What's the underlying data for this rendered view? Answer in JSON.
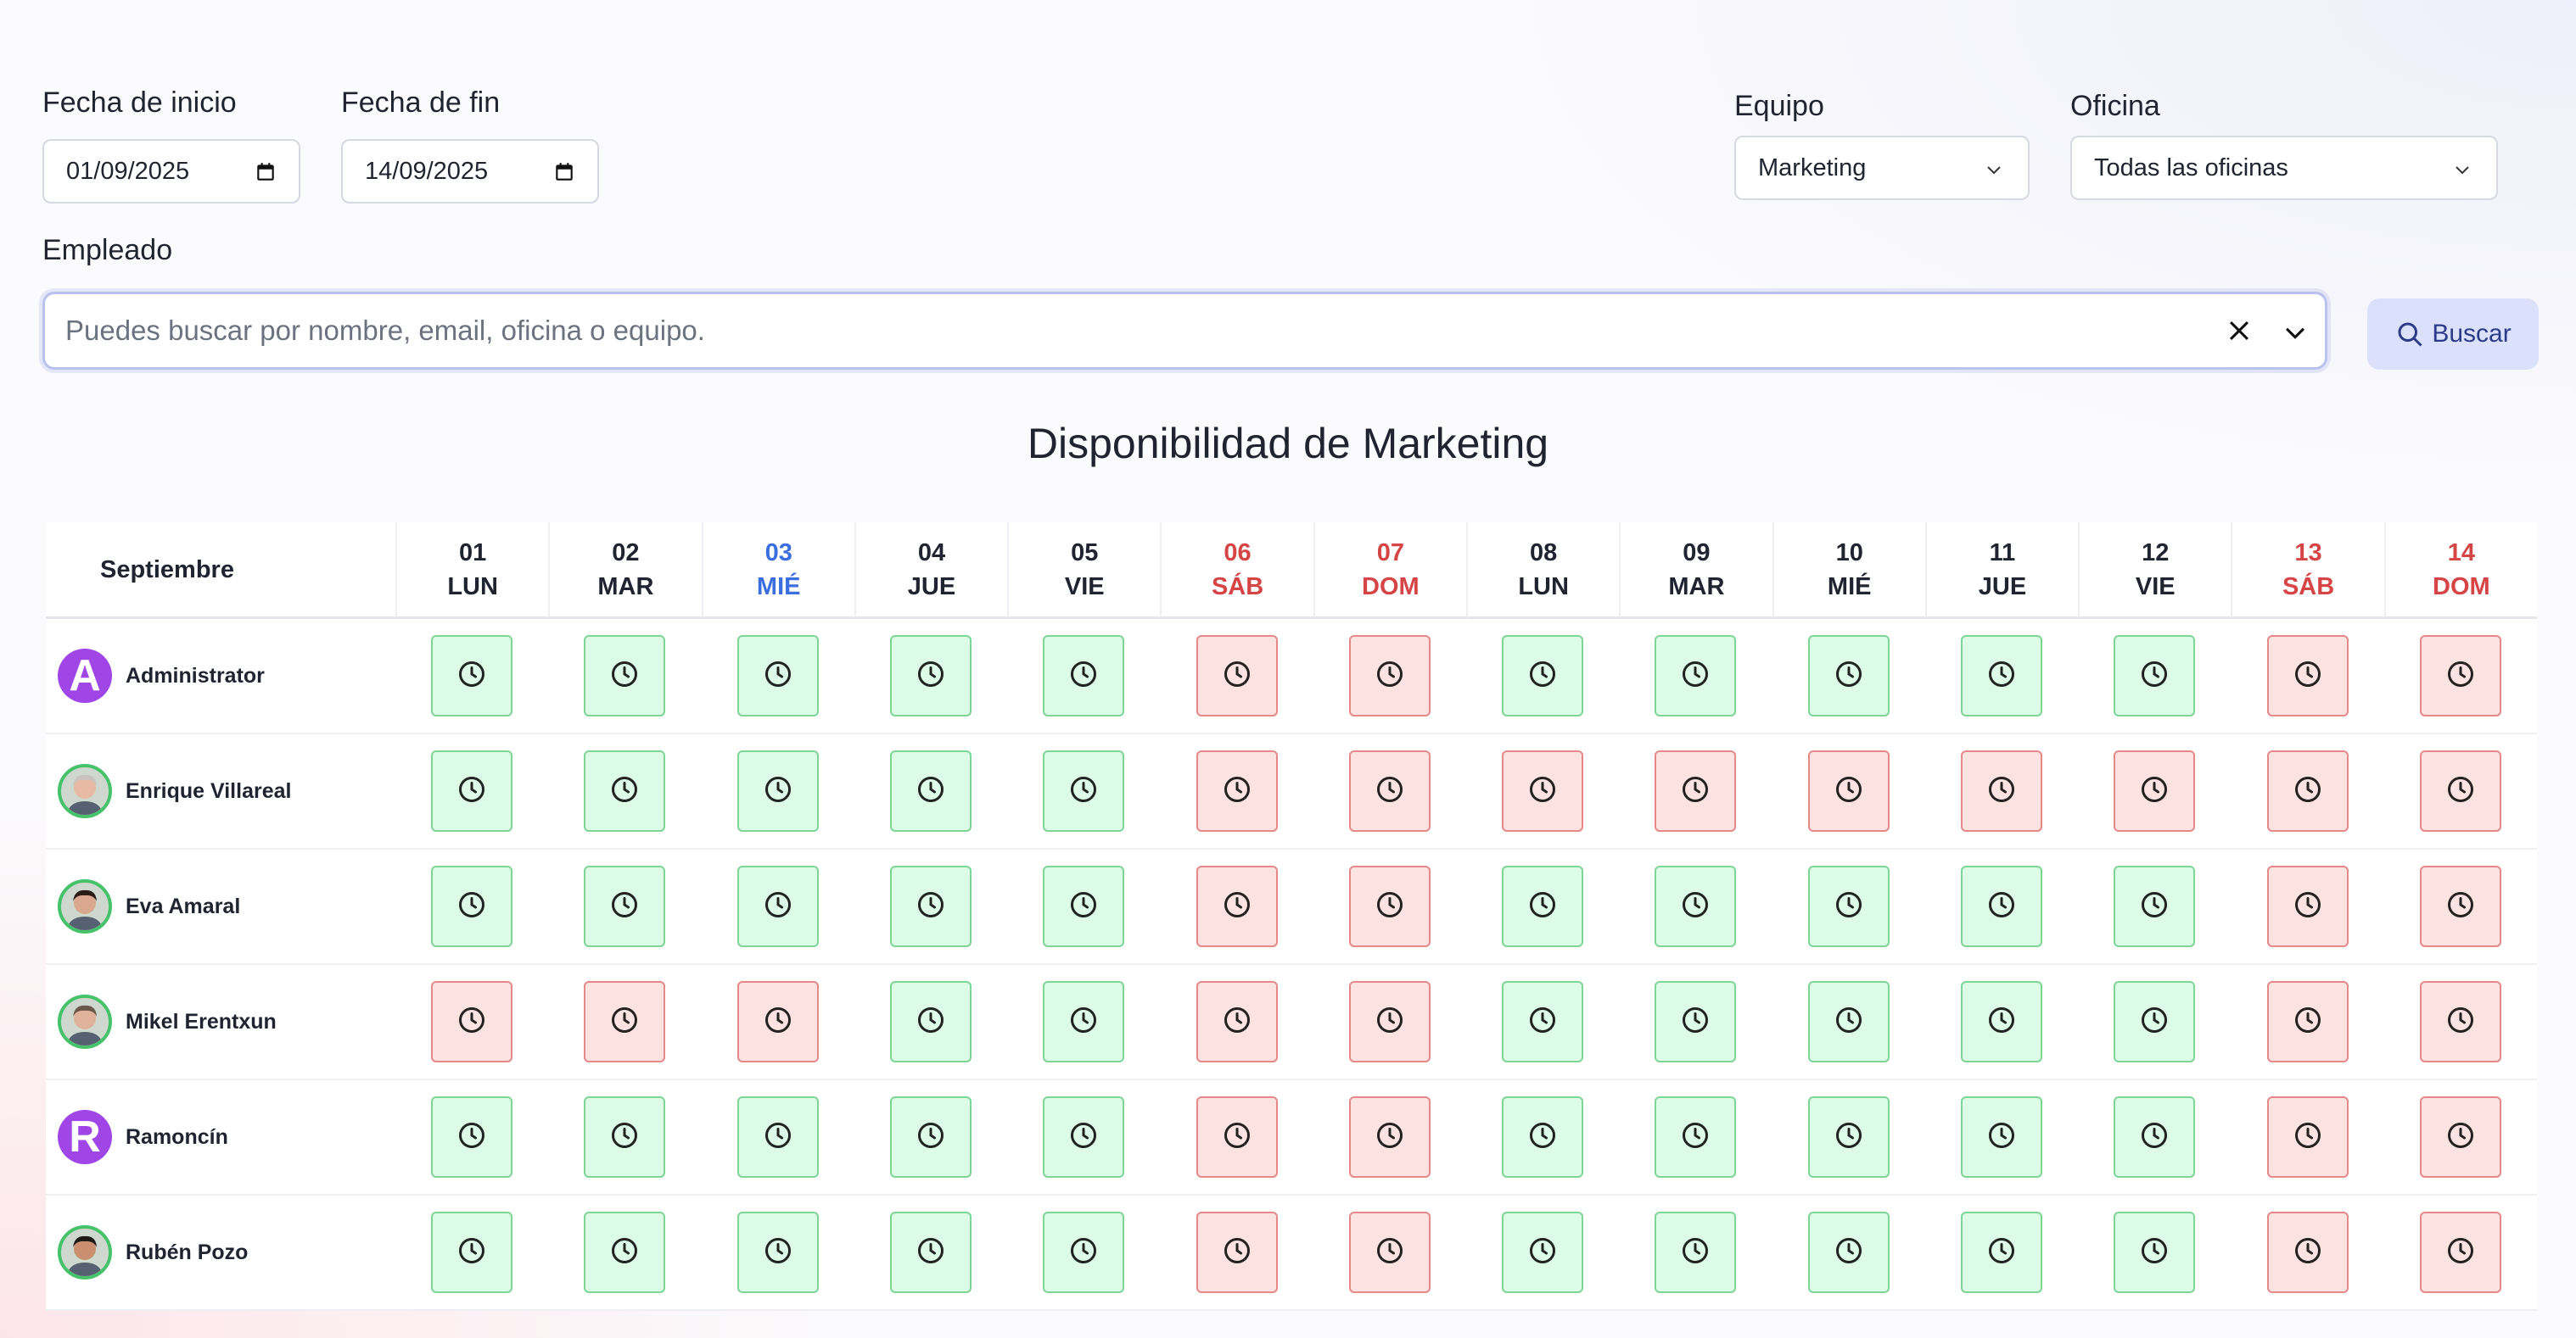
{
  "filters": {
    "start_label": "Fecha de inicio",
    "start_value": "01/09/2025",
    "end_label": "Fecha de fin",
    "end_value": "14/09/2025",
    "team_label": "Equipo",
    "team_value": "Marketing",
    "office_label": "Oficina",
    "office_value": "Todas las oficinas",
    "employee_label": "Empleado",
    "employee_placeholder": "Puedes buscar por nombre, email, oficina o equipo.",
    "search_button": "Buscar"
  },
  "title": "Disponibilidad de Marketing",
  "calendar": {
    "month": "Septiembre",
    "days": [
      {
        "num": "01",
        "dow": "LUN",
        "kind": "normal"
      },
      {
        "num": "02",
        "dow": "MAR",
        "kind": "normal"
      },
      {
        "num": "03",
        "dow": "MIÉ",
        "kind": "today"
      },
      {
        "num": "04",
        "dow": "JUE",
        "kind": "normal"
      },
      {
        "num": "05",
        "dow": "VIE",
        "kind": "normal"
      },
      {
        "num": "06",
        "dow": "SÁB",
        "kind": "weekend"
      },
      {
        "num": "07",
        "dow": "DOM",
        "kind": "weekend"
      },
      {
        "num": "08",
        "dow": "LUN",
        "kind": "normal"
      },
      {
        "num": "09",
        "dow": "MAR",
        "kind": "normal"
      },
      {
        "num": "10",
        "dow": "MIÉ",
        "kind": "normal"
      },
      {
        "num": "11",
        "dow": "JUE",
        "kind": "normal"
      },
      {
        "num": "12",
        "dow": "VIE",
        "kind": "normal"
      },
      {
        "num": "13",
        "dow": "SÁB",
        "kind": "weekend"
      },
      {
        "num": "14",
        "dow": "DOM",
        "kind": "weekend"
      }
    ],
    "employees": [
      {
        "name": "Administrator",
        "avatar": "letter",
        "initial": "A",
        "availability": [
          "available",
          "available",
          "available",
          "available",
          "available",
          "unavailable",
          "unavailable",
          "available",
          "available",
          "available",
          "available",
          "available",
          "unavailable",
          "unavailable"
        ]
      },
      {
        "name": "Enrique Villareal",
        "avatar": "photo-person-icon",
        "skin": "#e8b9a3",
        "hair": "#c9c2bd",
        "availability": [
          "available",
          "available",
          "available",
          "available",
          "available",
          "unavailable",
          "unavailable",
          "unavailable",
          "unavailable",
          "unavailable",
          "unavailable",
          "unavailable",
          "unavailable",
          "unavailable"
        ]
      },
      {
        "name": "Eva Amaral",
        "avatar": "photo-person-icon",
        "skin": "#d9a88e",
        "hair": "#2b1d18",
        "availability": [
          "available",
          "available",
          "available",
          "available",
          "available",
          "unavailable",
          "unavailable",
          "available",
          "available",
          "available",
          "available",
          "available",
          "unavailable",
          "unavailable"
        ]
      },
      {
        "name": "Mikel Erentxun",
        "avatar": "photo-person-icon",
        "skin": "#e0b29a",
        "hair": "#6b5a4a",
        "availability": [
          "unavailable",
          "unavailable",
          "unavailable",
          "available",
          "available",
          "unavailable",
          "unavailable",
          "available",
          "available",
          "available",
          "available",
          "available",
          "unavailable",
          "unavailable"
        ]
      },
      {
        "name": "Ramoncín",
        "avatar": "letter",
        "initial": "R",
        "availability": [
          "available",
          "available",
          "available",
          "available",
          "available",
          "unavailable",
          "unavailable",
          "available",
          "available",
          "available",
          "available",
          "available",
          "unavailable",
          "unavailable"
        ]
      },
      {
        "name": "Rubén Pozo",
        "avatar": "photo-person-icon",
        "skin": "#c98f6f",
        "hair": "#1e1a17",
        "availability": [
          "available",
          "available",
          "available",
          "available",
          "available",
          "unavailable",
          "unavailable",
          "available",
          "available",
          "available",
          "available",
          "available",
          "unavailable",
          "unavailable"
        ]
      }
    ]
  },
  "icons": {
    "calendar": "calendar-icon",
    "chevron": "chevron-down-icon",
    "clear": "close-icon",
    "search": "search-icon",
    "cell": "clock-icon"
  }
}
